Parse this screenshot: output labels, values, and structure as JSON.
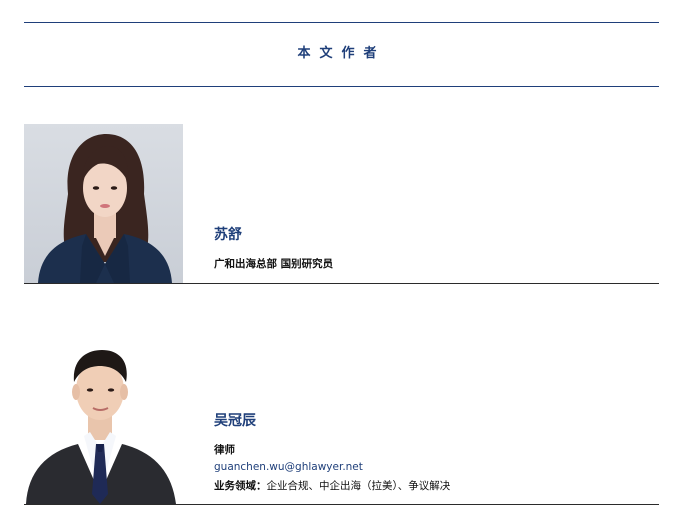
{
  "section": {
    "title": "本文作者"
  },
  "authors": [
    {
      "name": "苏舒",
      "title": "广和出海总部 国别研究员",
      "photo_icon": "portrait-female"
    },
    {
      "name": "吴冠辰",
      "title": "律师",
      "email": "guanchen.wu@ghlawyer.net",
      "field_label": "业务领域：",
      "field_value": "企业合规、中企出海（拉美）、争议解决",
      "photo_icon": "portrait-male"
    }
  ],
  "colors": {
    "accent": "#1f3f7a",
    "text": "#111111",
    "divider": "#2b2b2b"
  }
}
